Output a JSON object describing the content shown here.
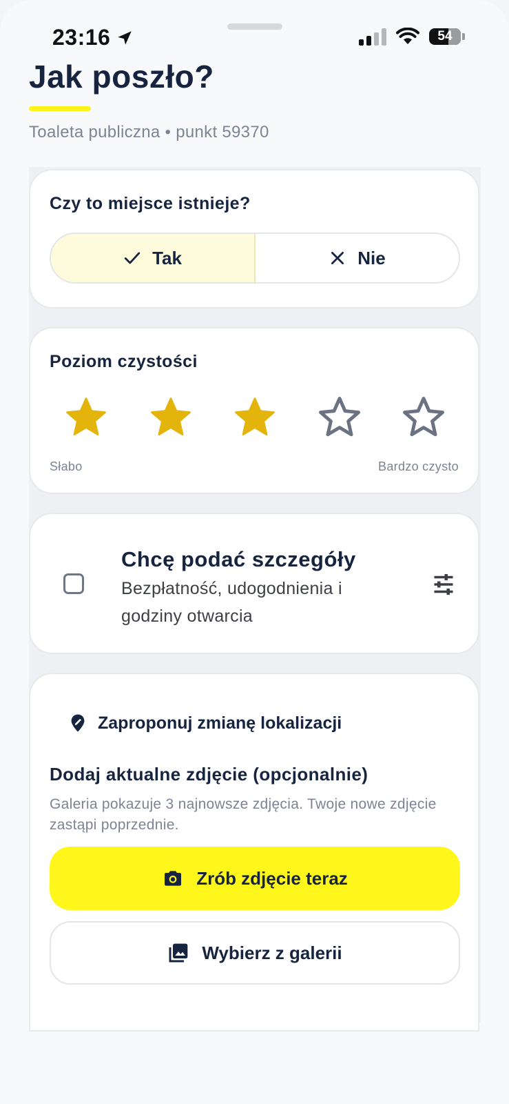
{
  "status_bar": {
    "time": "23:16",
    "battery": "54"
  },
  "header": {
    "title": "Jak poszło?",
    "subtitle": "Toaleta publiczna • punkt 59370"
  },
  "exists_card": {
    "question": "Czy to miejsce istnieje?",
    "yes_label": "Tak",
    "no_label": "Nie",
    "selected": "Tak"
  },
  "cleanliness_card": {
    "title": "Poziom czystości",
    "rating": 3,
    "max_rating": 5,
    "low_label": "Słabo",
    "high_label": "Bardzo czysto",
    "filled_color": "#e3b40c",
    "empty_color": "#6b7382"
  },
  "details_card": {
    "title": "Chcę podać szczegóły",
    "description": "Bezpłatność, udogodnienia i godziny otwarcia",
    "checked": false
  },
  "photo_card": {
    "location_link": "Zaproponuj zmianę lokalizacji",
    "title": "Dodaj aktualne zdjęcie (opcjonalnie)",
    "description": "Galeria pokazuje 3 najnowsze zdjęcia. Twoje nowe zdjęcie zastąpi poprzednie.",
    "take_photo_label": "Zrób zdjęcie teraz",
    "gallery_label": "Wybierz z galerii"
  },
  "colors": {
    "accent": "#fff61c",
    "text_dark": "#16243f",
    "muted": "#7c8493"
  }
}
